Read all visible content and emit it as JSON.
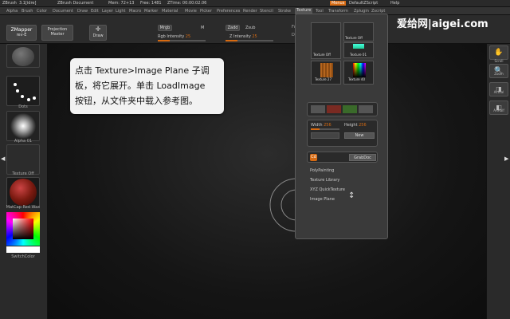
{
  "titlebar": {
    "app": "ZBrush",
    "version": "3.1[idre]",
    "document": "ZBrush Document",
    "mem": "Mem: 72+13",
    "free": "Free: 1481",
    "ztime": "ZTime: 00:00:02.06",
    "menus_label": "Menus",
    "script": "DefaultZScript",
    "help": "Help"
  },
  "menubar": {
    "items": [
      "Alpha",
      "Brush",
      "Color",
      "Document",
      "Draw",
      "Edit",
      "Layer",
      "Light",
      "Macro",
      "Marker",
      "Material",
      "Movie",
      "Picker",
      "Preferences",
      "Render",
      "Stencil",
      "Stroke",
      "Texture",
      "Tool",
      "Transform",
      "Zplugin",
      "Zscript"
    ],
    "active": "Texture"
  },
  "toolbar": {
    "zmapper": "ZMapper",
    "zmapper_sub": "rev-E",
    "projection": "Projection",
    "projection_sub": "Master",
    "draw": "Draw",
    "mrgb": "Mrgb",
    "m": "M",
    "rgb_intensity": "Rgb Intensity",
    "rgb_intensity_val": "25",
    "zadd": "Zadd",
    "zsub": "Zsub",
    "z_intensity": "Z Intensity",
    "z_intensity_val": "25",
    "focal": "Focal",
    "draw_size": "Draw"
  },
  "leftshelf": {
    "dots_label": "Dots",
    "alpha_label": "Alpha 01",
    "texture_label": "Texture Off",
    "matcap_label": "MatCap Red Wax",
    "switchcolor": "SwitchColor"
  },
  "texture_palette": {
    "slot1": "Texture Off",
    "slot2": "Texture Off",
    "slot3": "Texture 27",
    "slot4": "Texture 01",
    "slot5": "Texture 40",
    "width_label": "Width",
    "width_val": "256",
    "height_label": "Height",
    "height_val": "256",
    "new_btn": "New",
    "grabdoc": "GrabDoc",
    "cd": "Cd",
    "polypainting": "PolyPainting",
    "texture_library": "Texture Library",
    "xyz_quicktexture": "XYZ QuickTexture",
    "image_plane": "Image Plane"
  },
  "rightshelf": {
    "scroll": "Scroll",
    "zoom": "Zoom",
    "actual": "Actual",
    "aahalf": "AAHalf"
  },
  "callout": {
    "line1": "点击 Texture>Image Plane 子调",
    "line2": "板，将它展开。单击 LoadImage",
    "line3": "按钮，从文件夹中载入参考图。"
  },
  "watermark": "爱给网|aigei.com",
  "colors": {
    "accent": "#d66a12",
    "panel": "#3a3a3a",
    "callout_bg": "#f2f2f2"
  }
}
